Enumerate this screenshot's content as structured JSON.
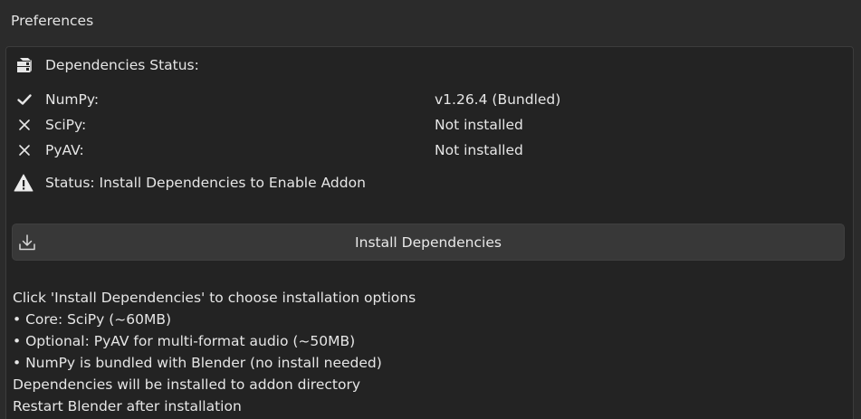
{
  "header": {
    "title": "Preferences"
  },
  "dependencies": {
    "heading": "Dependencies Status:",
    "heading_icon": "package-icon",
    "items": [
      {
        "name": "NumPy:",
        "status": "v1.26.4 (Bundled)",
        "icon": "checkmark-icon"
      },
      {
        "name": "SciPy:",
        "status": "Not installed",
        "icon": "x-icon"
      },
      {
        "name": "PyAV:",
        "status": "Not installed",
        "icon": "x-icon"
      }
    ],
    "status_message": "Status: Install Dependencies to Enable Addon",
    "status_icon": "warning-icon"
  },
  "install_button": {
    "label": "Install Dependencies",
    "icon": "download-icon"
  },
  "info": {
    "lines": [
      "Click 'Install Dependencies' to choose installation options",
      "• Core: SciPy (~60MB)",
      "• Optional: PyAV for multi-format audio (~50MB)",
      "• NumPy is bundled with Blender (no install needed)",
      "Dependencies will be installed to addon directory",
      "Restart Blender after installation"
    ]
  },
  "colors": {
    "background": "#2b2b2b",
    "panel": "#232323",
    "button": "#383838",
    "text": "#e6e6e6"
  }
}
